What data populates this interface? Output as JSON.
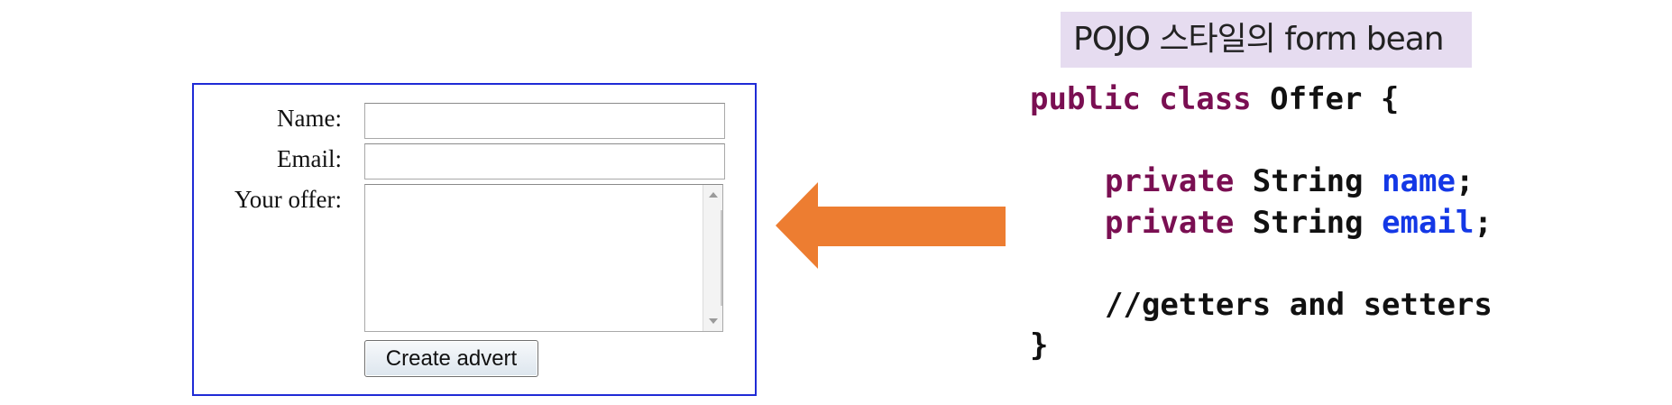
{
  "form": {
    "name_label": "Name:",
    "email_label": "Email:",
    "offer_label": "Your offer:",
    "name_value": "",
    "email_value": "",
    "offer_value": "",
    "submit_label": "Create advert"
  },
  "title": "POJO 스타일의 form bean",
  "code": {
    "line1": {
      "kw": "public class",
      "rest": " Offer {"
    },
    "line2": {
      "kw": "private",
      "type": " String ",
      "field": "name",
      "end": ";"
    },
    "line3": {
      "kw": "private",
      "type": " String ",
      "field": "email",
      "end": ";"
    },
    "line4": {
      "comment": "//getters and setters"
    },
    "line5": {
      "text": "}"
    }
  },
  "colors": {
    "form_border": "#1f2bd6",
    "arrow": "#ed7d31",
    "title_background": "#e6dcf0",
    "keyword": "#7a0f52",
    "field": "#1438e6"
  },
  "icons": {
    "arrow": "left-arrow-icon",
    "scroll_up": "scroll-up-icon",
    "scroll_down": "scroll-down-icon"
  }
}
